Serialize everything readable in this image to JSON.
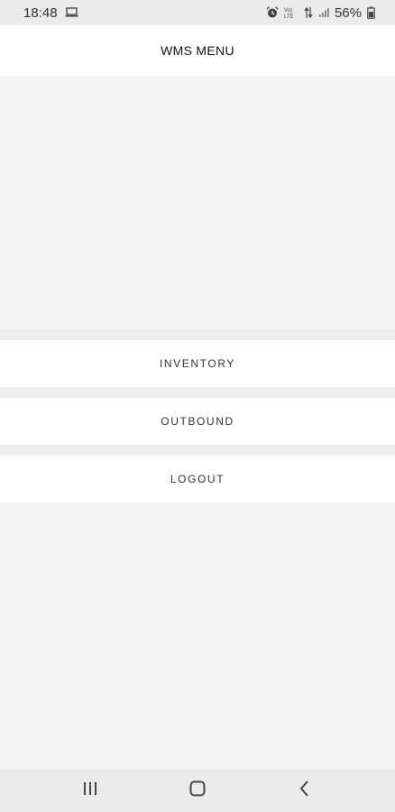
{
  "status_bar": {
    "time": "18:48",
    "battery": "56%",
    "icons": [
      "laptop-icon",
      "alarm-icon",
      "volte-icon",
      "data-arrows-icon",
      "signal-icon",
      "battery-icon"
    ]
  },
  "header": {
    "title": "WMS MENU"
  },
  "menu": {
    "items": [
      {
        "label": "INVENTORY"
      },
      {
        "label": "OUTBOUND"
      },
      {
        "label": "LOGOUT"
      }
    ]
  },
  "nav_bar": {
    "icons": [
      "recent-apps-icon",
      "home-icon",
      "back-icon"
    ]
  }
}
